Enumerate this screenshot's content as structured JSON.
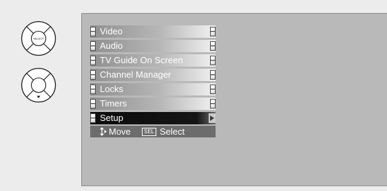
{
  "remote": {
    "select_button_label": "SELECT"
  },
  "menu": {
    "items": [
      {
        "label": "Video"
      },
      {
        "label": "Audio"
      },
      {
        "label": "TV Guide On Screen"
      },
      {
        "label": "Channel Manager"
      },
      {
        "label": "Locks"
      },
      {
        "label": "Timers"
      },
      {
        "label": "Setup",
        "selected": true
      }
    ]
  },
  "footer": {
    "move_label": "Move",
    "sel_badge": "SEL",
    "select_label": "Select"
  },
  "icons": {
    "move": "four-way-arrow-icon",
    "select_remote": "remote-select-button-icon",
    "down_remote": "remote-down-button-icon"
  }
}
